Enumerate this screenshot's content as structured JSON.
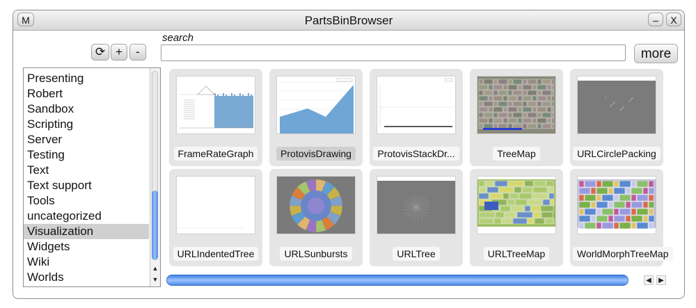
{
  "window": {
    "title": "PartsBinBrowser",
    "menu_label": "M",
    "minimize_label": "–",
    "close_label": "X"
  },
  "toolbar": {
    "reload_icon": "reload-icon",
    "reload_label": "⟳",
    "add_label": "+",
    "remove_label": "-"
  },
  "search": {
    "label": "search",
    "value": "",
    "more_label": "more"
  },
  "categories": {
    "items": [
      "Presenting",
      "Robert",
      "Sandbox",
      "Scripting",
      "Server",
      "Testing",
      "Text",
      "Text support",
      "Tools",
      "uncategorized",
      "Visualization",
      "Widgets",
      "Wiki",
      "Worlds"
    ],
    "selected": "Visualization",
    "scroll_position": 0.9
  },
  "parts": [
    {
      "name": "FrameRateGraph",
      "thumb": "frame-rate-graph-thumbnail"
    },
    {
      "name": "ProtovisDrawing",
      "thumb": "protovis-area-chart-thumbnail",
      "selected": true
    },
    {
      "name": "ProtovisStackDr...",
      "thumb": "protovis-stack-thumbnail"
    },
    {
      "name": "TreeMap",
      "thumb": "treemap-thumbnail"
    },
    {
      "name": "URLCirclePacking",
      "thumb": "circle-packing-thumbnail"
    },
    {
      "name": "URLIndentedTree",
      "thumb": "indented-tree-thumbnail"
    },
    {
      "name": "URLSunbursts",
      "thumb": "sunburst-thumbnail"
    },
    {
      "name": "URLTree",
      "thumb": "tree-thumbnail"
    },
    {
      "name": "URLTreeMap",
      "thumb": "url-treemap-thumbnail"
    },
    {
      "name": "WorldMorphTreeMap",
      "thumb": "world-treemap-thumbnail"
    }
  ],
  "scroll": {
    "horizontal_position": 0.0,
    "left_arrow": "◀",
    "right_arrow": "▶",
    "up_arrow": "▲",
    "down_arrow": "▼"
  },
  "colors": {
    "accent_blue": "#4f86e0",
    "chart_blue": "#74aad8",
    "selection": "#d0d0d0"
  }
}
